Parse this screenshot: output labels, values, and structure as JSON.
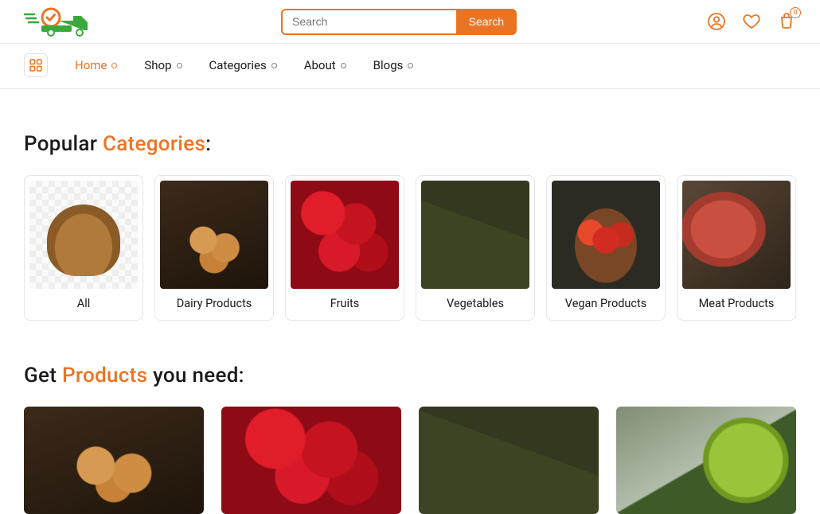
{
  "header": {
    "search_placeholder": "Search",
    "search_button": "Search",
    "cart_count": "0"
  },
  "nav": {
    "items": [
      {
        "label": "Home",
        "active": true
      },
      {
        "label": "Shop",
        "active": false
      },
      {
        "label": "Categories",
        "active": false
      },
      {
        "label": "About",
        "active": false
      },
      {
        "label": "Blogs",
        "active": false
      }
    ]
  },
  "sections": {
    "categories": {
      "title_pre": "Popular ",
      "title_accent": "Categories",
      "title_post": ":"
    },
    "products": {
      "title_pre": "Get ",
      "title_accent": "Products",
      "title_post": " you need:"
    }
  },
  "categories": [
    {
      "label": "All",
      "thumb": "all"
    },
    {
      "label": "Dairy Products",
      "thumb": "dairy"
    },
    {
      "label": "Fruits",
      "thumb": "fruits"
    },
    {
      "label": "Vegetables",
      "thumb": "veg"
    },
    {
      "label": "Vegan Products",
      "thumb": "vegan"
    },
    {
      "label": "Meat Products",
      "thumb": "meat"
    }
  ],
  "products_preview": [
    {
      "thumb": "dairy"
    },
    {
      "thumb": "fruits"
    },
    {
      "thumb": "veg"
    },
    {
      "thumb": "green"
    }
  ]
}
